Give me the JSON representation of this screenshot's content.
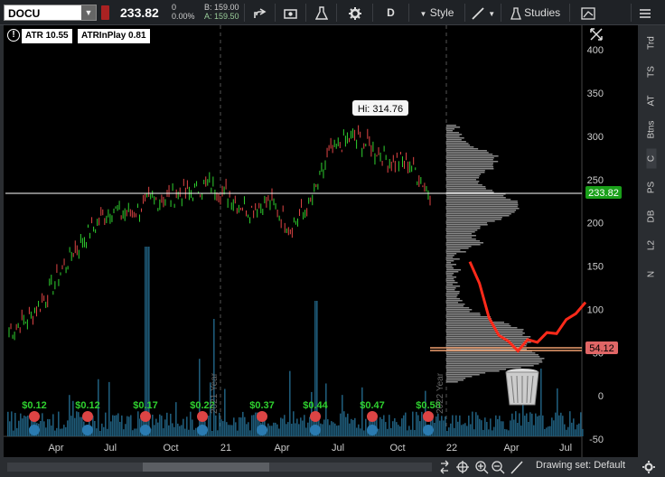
{
  "toolbar": {
    "symbol": "DOCU",
    "price": "233.82",
    "change": "0",
    "change_pct": "0.00%",
    "bid": "B: 159.00",
    "ask": "A: 159.50",
    "period": "D",
    "style_label": "Style",
    "studies_label": "Studies"
  },
  "studies": {
    "atr": "ATR 10.55",
    "atr_in_play": "ATRInPlay  0.81"
  },
  "price_axis": [
    "400",
    "350",
    "300",
    "250",
    "200",
    "150",
    "100",
    "50",
    "0",
    "-50"
  ],
  "price_tags": {
    "last": "233.82",
    "low_level": "54.12"
  },
  "hi_label": "Hi: 314.76",
  "dividends": [
    "$0.12",
    "$0.12",
    "$0.17",
    "$0.22",
    "$0.37",
    "$0.44",
    "$0.47",
    "$0.58"
  ],
  "time_axis": [
    "Apr",
    "Jul",
    "Oct",
    "21",
    "Apr",
    "Jul",
    "Oct",
    "22",
    "Apr",
    "Jul"
  ],
  "year_markers": [
    "2021 Year",
    "2022 Year"
  ],
  "drawing_set": "Drawing set: Default",
  "side_tabs": [
    "Trd",
    "TS",
    "AT",
    "Btns",
    "C",
    "PS",
    "DB",
    "L2",
    "N"
  ],
  "colors": {
    "up": "#2fd12f",
    "down": "#e04545",
    "last_tag": "#1aa01a",
    "low_tag": "#e06666",
    "volume": "#1e5a78",
    "annotation": "#ff2a1a"
  },
  "chart_data": {
    "type": "line",
    "title": "",
    "ylim": [
      -50,
      420
    ],
    "x": [
      "2020-03",
      "2020-04",
      "2020-05",
      "2020-06",
      "2020-07",
      "2020-08",
      "2020-09",
      "2020-10",
      "2020-11",
      "2020-12",
      "2021-01",
      "2021-02",
      "2021-03",
      "2021-04",
      "2021-05",
      "2021-06",
      "2021-07",
      "2021-08",
      "2021-09",
      "2021-10",
      "2021-11",
      "2021-12"
    ],
    "series": [
      {
        "values": [
          75,
          90,
          120,
          160,
          190,
          215,
          210,
          225,
          230,
          235,
          245,
          230,
          215,
          225,
          195,
          220,
          280,
          300,
          290,
          270,
          270,
          233.82
        ]
      }
    ],
    "projection_values": [
      155,
      130,
      90,
      70,
      60,
      55,
      62,
      65,
      70,
      75,
      85,
      95,
      108
    ]
  }
}
